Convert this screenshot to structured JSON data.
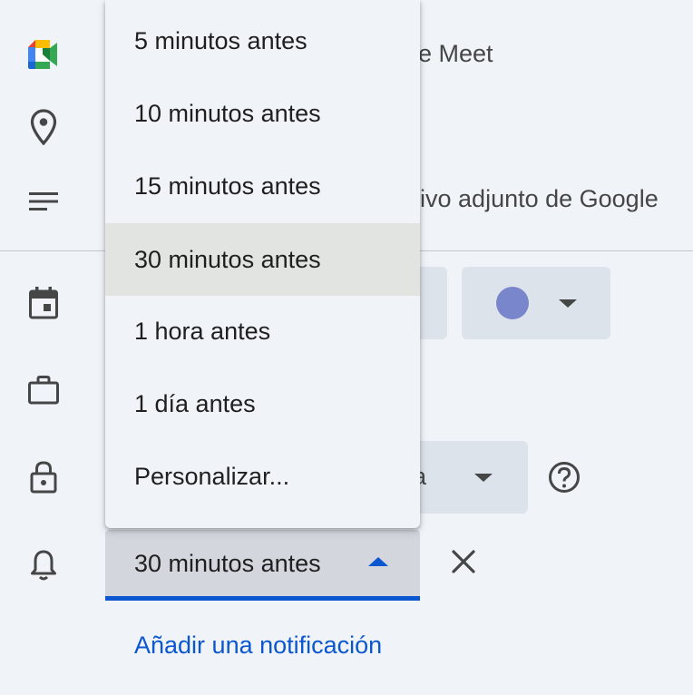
{
  "background_rows": {
    "meet_text": "gle Meet",
    "attachment_text": "hivo adjunto de Google"
  },
  "visibility": {
    "partial_label": "da"
  },
  "reminder": {
    "selected_value": "30 minutos antes"
  },
  "dropdown": {
    "options": [
      "5 minutos antes",
      "10 minutos antes",
      "15 minutos antes",
      "30 minutos antes",
      "1 hora antes",
      "1 día antes",
      "Personalizar..."
    ],
    "selected_index": 3
  },
  "add_notification_label": "Añadir una notificación",
  "colors": {
    "accent": "#0b57d0",
    "event_color": "#7986cb",
    "background": "#f0f4f9"
  },
  "icons": [
    "google-meet-icon",
    "location-icon",
    "description-icon",
    "calendar-icon",
    "briefcase-icon",
    "lock-icon",
    "bell-icon",
    "help-icon",
    "close-icon"
  ]
}
